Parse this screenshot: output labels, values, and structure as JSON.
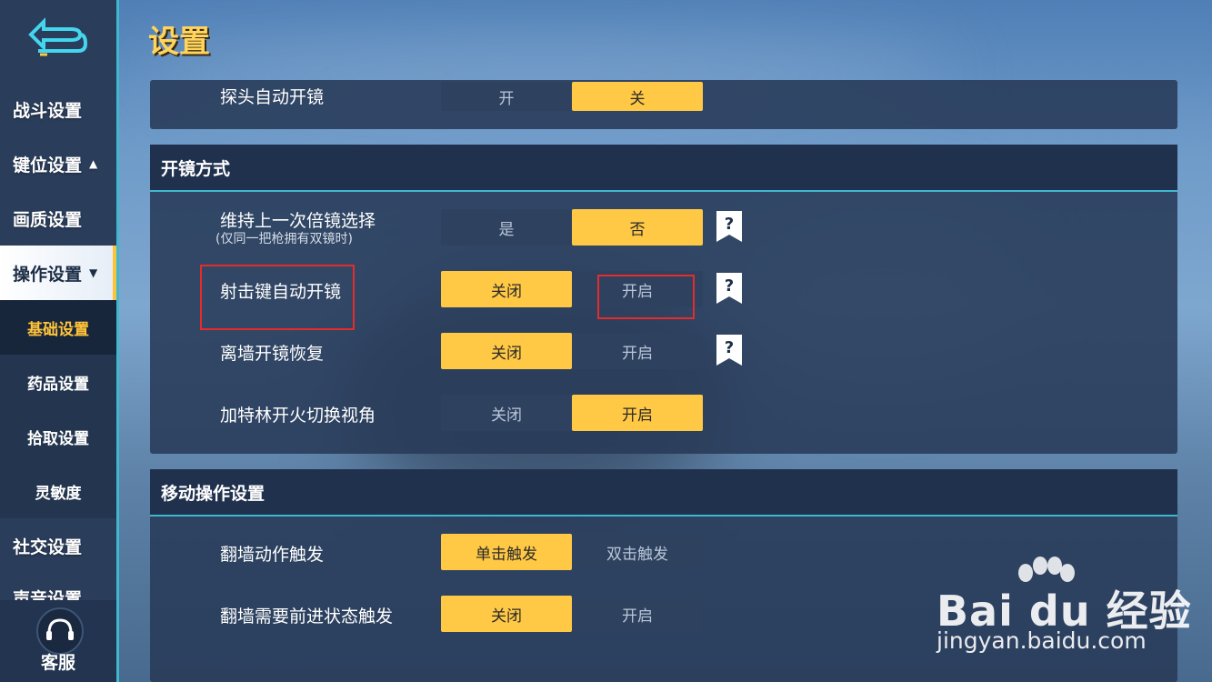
{
  "page": {
    "title": "设置"
  },
  "sidebar": {
    "items": [
      {
        "label": "战斗设置"
      },
      {
        "label": "键位设置",
        "caret": "▲"
      },
      {
        "label": "画质设置"
      },
      {
        "label": "操作设置",
        "caret": "▼"
      }
    ],
    "sub_items": [
      {
        "label": "基础设置"
      },
      {
        "label": "药品设置"
      },
      {
        "label": "拾取设置"
      },
      {
        "label": "灵敏度"
      },
      {
        "label": "社交设置"
      },
      {
        "label": "声音设置"
      }
    ],
    "service_label": "客服"
  },
  "panels": {
    "top": {
      "rows": [
        {
          "label": "探头自动开镜",
          "options": [
            "开",
            "关"
          ],
          "selected": "关"
        }
      ]
    },
    "scope": {
      "header": "开镜方式",
      "rows": [
        {
          "label": "维持上一次倍镜选择",
          "sublabel": "(仅同一把枪拥有双镜时)",
          "options": [
            "是",
            "否"
          ],
          "selected": "否",
          "help": true
        },
        {
          "label": "射击键自动开镜",
          "options": [
            "关闭",
            "开启"
          ],
          "selected": "关闭",
          "help": true,
          "highlighted": true
        },
        {
          "label": "离墙开镜恢复",
          "options": [
            "关闭",
            "开启"
          ],
          "selected": "关闭",
          "help": true
        },
        {
          "label": "加特林开火切换视角",
          "options": [
            "关闭",
            "开启"
          ],
          "selected": "开启"
        }
      ]
    },
    "move": {
      "header": "移动操作设置",
      "rows": [
        {
          "label": "翻墙动作触发",
          "options": [
            "单击触发",
            "双击触发"
          ],
          "selected": "单击触发"
        },
        {
          "label": "翻墙需要前进状态触发",
          "options": [
            "关闭",
            "开启"
          ],
          "selected": "关闭"
        }
      ]
    }
  },
  "watermark": {
    "line1": "Bai du 经验",
    "line2": "jingyan.baidu.com"
  },
  "colors": {
    "accent": "#ffc845",
    "highlight_box": "#e52b2b",
    "sidebar": "#2a3d5b",
    "title": "#ffd45c"
  }
}
